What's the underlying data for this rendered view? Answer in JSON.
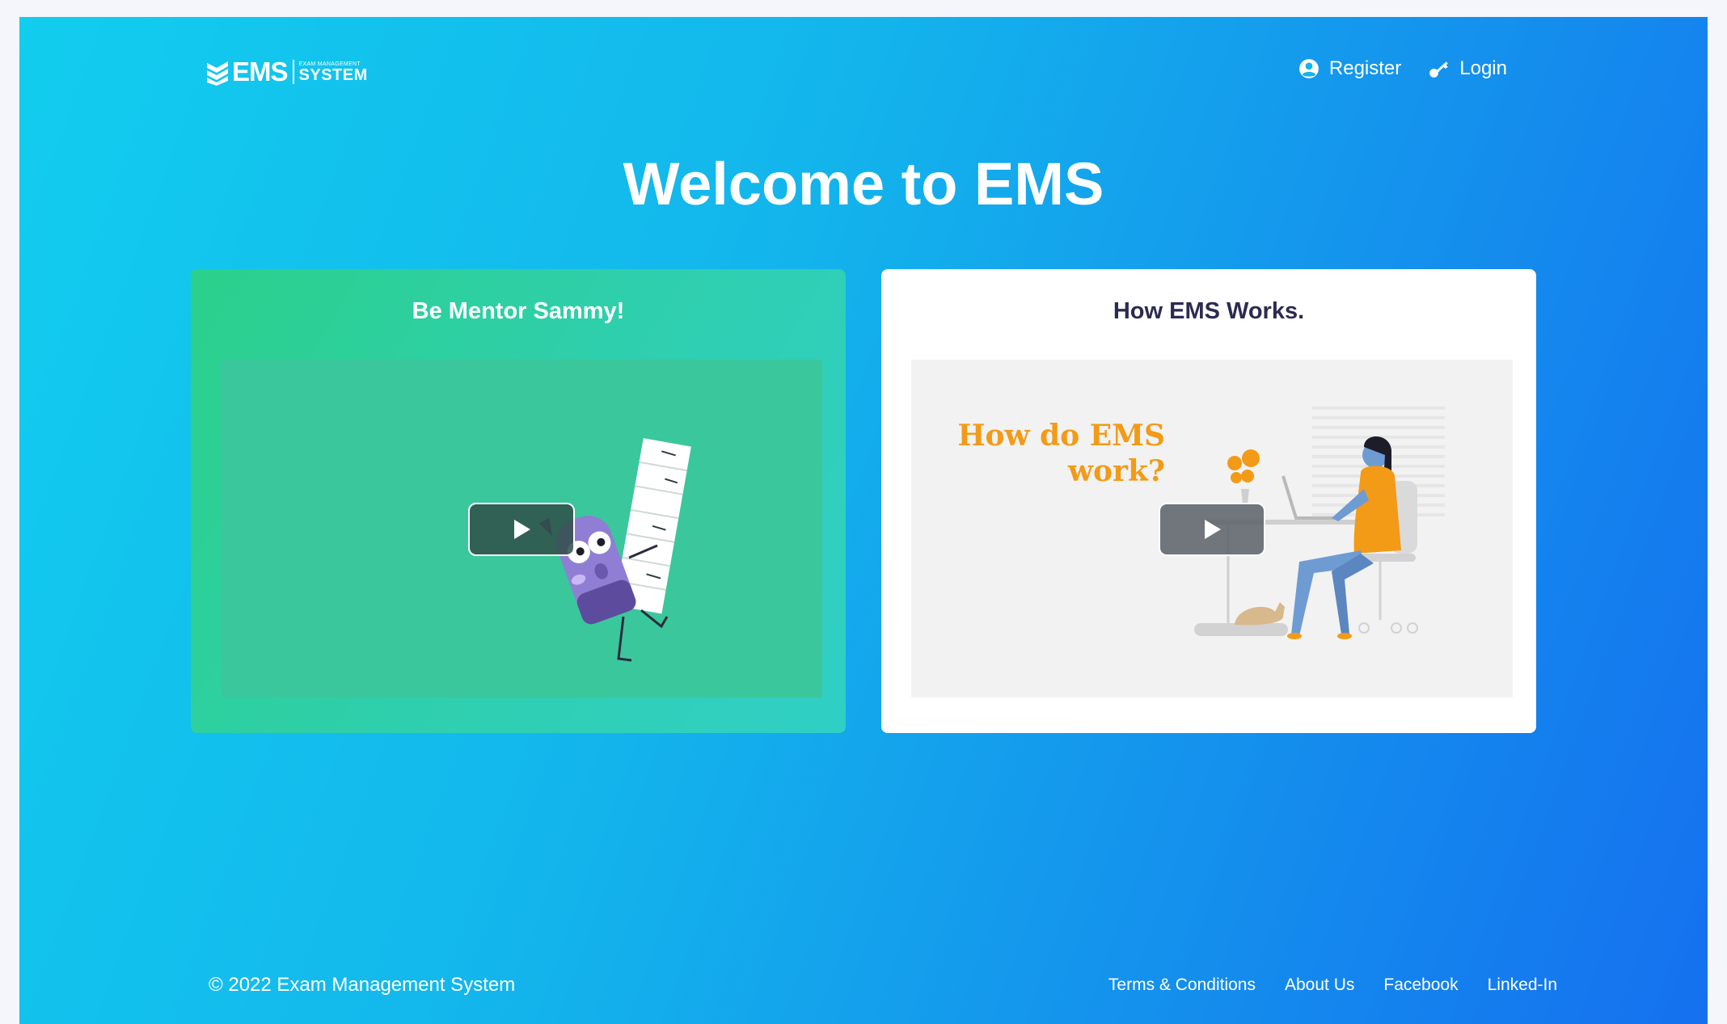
{
  "brand": {
    "name": "EMS",
    "tagline_small": "EXAM MANAGEMENT",
    "tagline_large": "SYSTEM"
  },
  "nav": {
    "register": "Register",
    "login": "Login"
  },
  "hero": {
    "title": "Welcome to EMS"
  },
  "cards": [
    {
      "title": "Be Mentor Sammy!",
      "video_label": ""
    },
    {
      "title": "How EMS Works.",
      "video_text_line1": "How do EMS",
      "video_text_line2": "work?"
    }
  ],
  "footer": {
    "copyright": "© 2022 Exam Management System",
    "links": [
      "Terms & Conditions",
      "About Us",
      "Facebook",
      "Linked-In"
    ]
  },
  "colors": {
    "gradient_start": "#12cdee",
    "gradient_end": "#1570ef",
    "card_green": "#2bd08b",
    "accent_orange": "#f39a16",
    "title_dark": "#2b2b52"
  }
}
